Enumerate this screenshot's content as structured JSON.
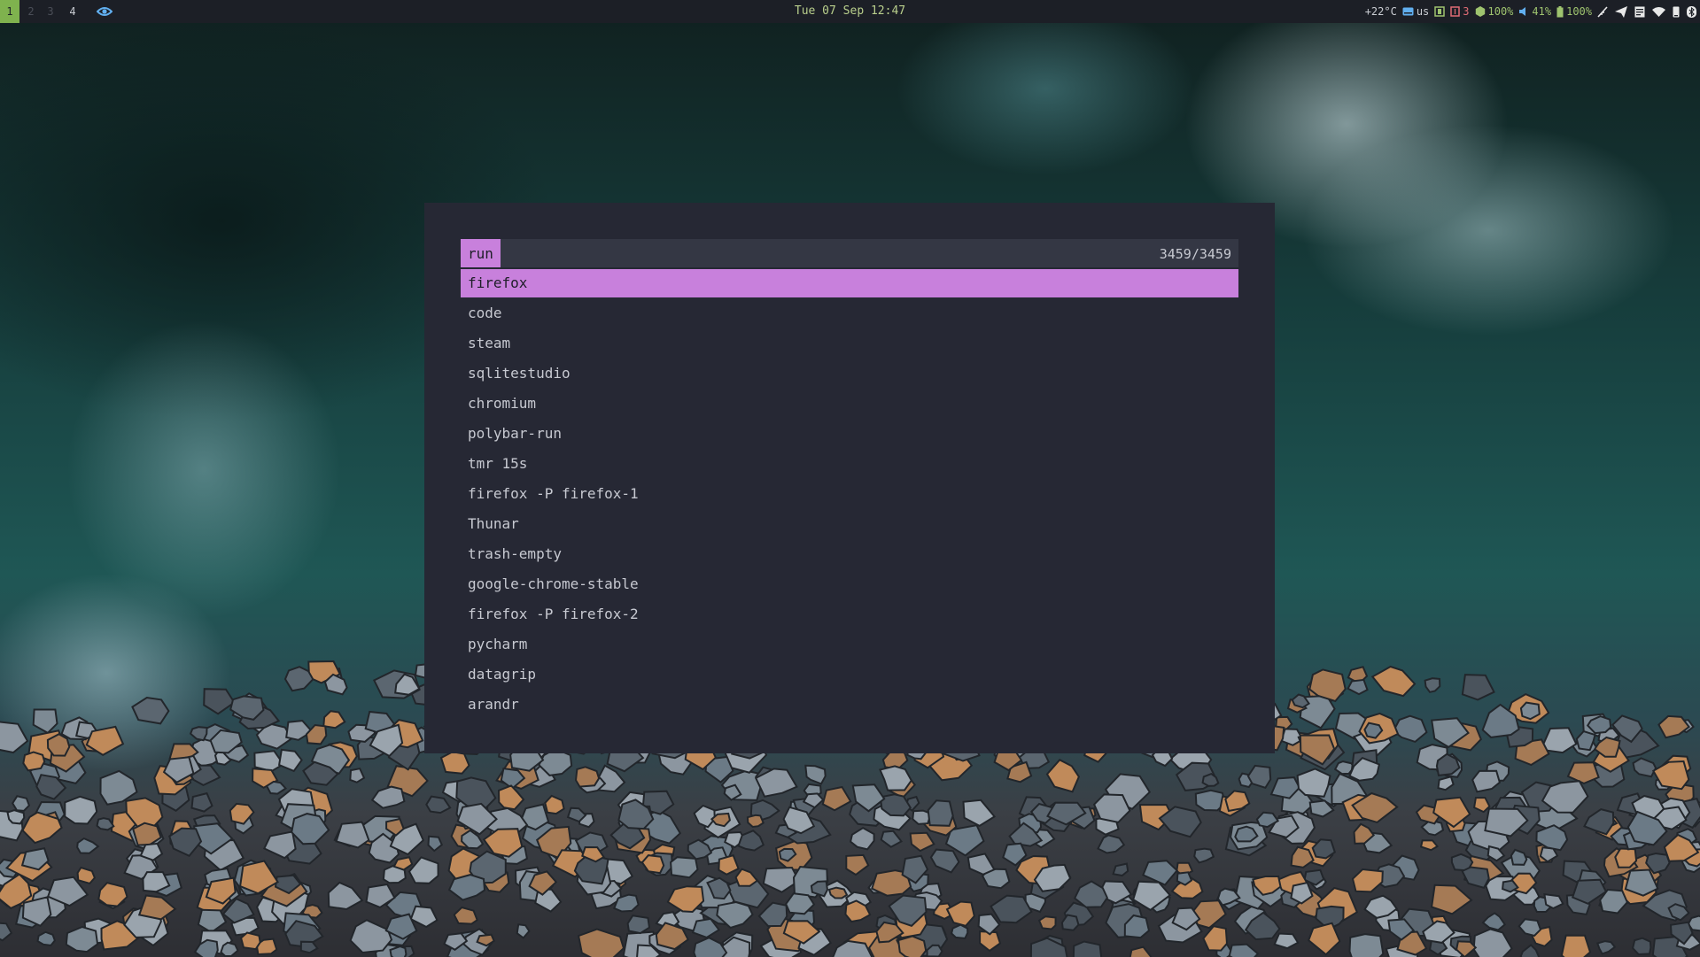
{
  "topbar": {
    "workspaces": [
      {
        "label": "1",
        "state": "active"
      },
      {
        "label": "2",
        "state": "empty"
      },
      {
        "label": "3",
        "state": "empty"
      },
      {
        "label": "4",
        "state": "occupied"
      }
    ],
    "clock": "Tue 07 Sep 12:47",
    "tray": {
      "temperature": "+22°C",
      "keyboard_layout": "us",
      "notification_count": "3",
      "cpu": "100%",
      "volume": "41%",
      "battery": "100%"
    }
  },
  "launcher": {
    "prompt": "run",
    "query": "",
    "count": "3459/3459",
    "results": [
      "firefox",
      "code",
      "steam",
      "sqlitestudio",
      "chromium",
      "polybar-run",
      "tmr 15s",
      "firefox -P firefox-1",
      "Thunar",
      "trash-empty",
      "google-chrome-stable",
      "firefox -P firefox-2",
      "pycharm",
      "datagrip",
      "arandr"
    ],
    "selected_index": 0
  },
  "colors": {
    "accent": "#c880dc",
    "launcher_bg": "#262834",
    "bar_bg": "#1c1f26",
    "workspace_active": "#7fb24e"
  }
}
